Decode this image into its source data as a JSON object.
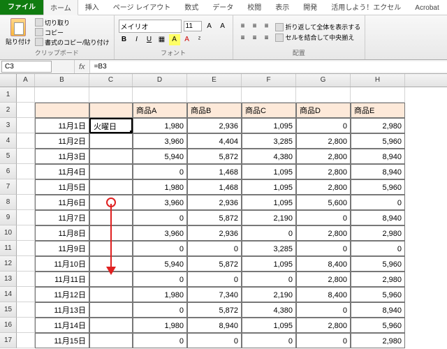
{
  "tabs": {
    "file": "ファイル",
    "home": "ホーム",
    "insert": "挿入",
    "layout": "ページ レイアウト",
    "formula": "数式",
    "data": "データ",
    "review": "校閲",
    "view": "表示",
    "dev": "開発",
    "util": "活用しよう！エクセル",
    "acrobat": "Acrobat"
  },
  "clipboard": {
    "paste": "貼り付け",
    "cut": "切り取り",
    "copy": "コピー",
    "fmt": "書式のコピー/貼り付け",
    "label": "クリップボード"
  },
  "font": {
    "name": "メイリオ",
    "size": "11",
    "label": "フォント"
  },
  "align": {
    "wrap": "折り返して全体を表示する",
    "merge": "セルを結合して中央揃え",
    "label": "配置"
  },
  "namebox": "C3",
  "formula": "=B3",
  "cols": [
    "A",
    "B",
    "C",
    "D",
    "E",
    "F",
    "G",
    "H"
  ],
  "headers": {
    "c": "",
    "d": "商品A",
    "e": "商品B",
    "f": "商品C",
    "g": "商品D",
    "h": "商品E"
  },
  "rows": [
    {
      "b": "11月1日",
      "c": "火曜日",
      "d": "1,980",
      "e": "2,936",
      "f": "1,095",
      "g": "0",
      "h": "2,980"
    },
    {
      "b": "11月2日",
      "c": "",
      "d": "3,960",
      "e": "4,404",
      "f": "3,285",
      "g": "2,800",
      "h": "5,960"
    },
    {
      "b": "11月3日",
      "c": "",
      "d": "5,940",
      "e": "5,872",
      "f": "4,380",
      "g": "2,800",
      "h": "8,940"
    },
    {
      "b": "11月4日",
      "c": "",
      "d": "0",
      "e": "1,468",
      "f": "1,095",
      "g": "2,800",
      "h": "8,940"
    },
    {
      "b": "11月5日",
      "c": "",
      "d": "1,980",
      "e": "1,468",
      "f": "1,095",
      "g": "2,800",
      "h": "5,960"
    },
    {
      "b": "11月6日",
      "c": "",
      "d": "3,960",
      "e": "2,936",
      "f": "1,095",
      "g": "5,600",
      "h": "0"
    },
    {
      "b": "11月7日",
      "c": "",
      "d": "0",
      "e": "5,872",
      "f": "2,190",
      "g": "0",
      "h": "8,940"
    },
    {
      "b": "11月8日",
      "c": "",
      "d": "3,960",
      "e": "2,936",
      "f": "0",
      "g": "2,800",
      "h": "2,980"
    },
    {
      "b": "11月9日",
      "c": "",
      "d": "0",
      "e": "0",
      "f": "3,285",
      "g": "0",
      "h": "0"
    },
    {
      "b": "11月10日",
      "c": "",
      "d": "5,940",
      "e": "5,872",
      "f": "1,095",
      "g": "8,400",
      "h": "5,960"
    },
    {
      "b": "11月11日",
      "c": "",
      "d": "0",
      "e": "0",
      "f": "0",
      "g": "2,800",
      "h": "2,980"
    },
    {
      "b": "11月12日",
      "c": "",
      "d": "1,980",
      "e": "7,340",
      "f": "2,190",
      "g": "8,400",
      "h": "5,960"
    },
    {
      "b": "11月13日",
      "c": "",
      "d": "0",
      "e": "5,872",
      "f": "4,380",
      "g": "0",
      "h": "8,940"
    },
    {
      "b": "11月14日",
      "c": "",
      "d": "1,980",
      "e": "8,940",
      "f": "1,095",
      "g": "2,800",
      "h": "5,960"
    },
    {
      "b": "11月15日",
      "c": "",
      "d": "0",
      "e": "0",
      "f": "0",
      "g": "0",
      "h": "2,980"
    }
  ]
}
